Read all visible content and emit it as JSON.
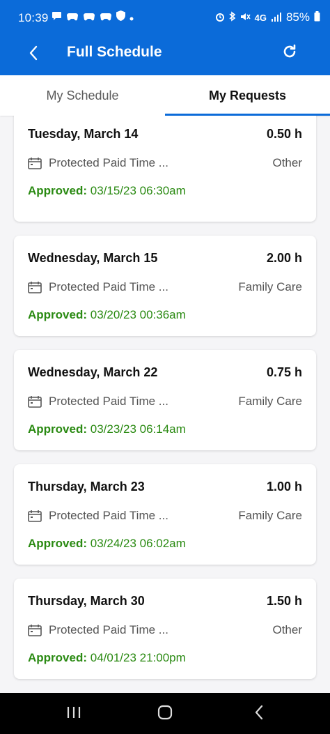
{
  "status_bar": {
    "time": "10:39",
    "network": "4G",
    "battery": "85%"
  },
  "app_bar": {
    "title": "Full Schedule",
    "back_icon": "chevron-left-icon",
    "refresh_icon": "refresh-icon"
  },
  "tabs": [
    {
      "label": "My Schedule",
      "active": false
    },
    {
      "label": "My Requests",
      "active": true
    }
  ],
  "requests": [
    {
      "date": "Tuesday, March 14",
      "hours": "0.50 h",
      "type": "Protected Paid Time ...",
      "category": "Other",
      "status": "Approved:",
      "timestamp": "03/15/23 06:30am"
    },
    {
      "date": "Wednesday, March 15",
      "hours": "2.00 h",
      "type": "Protected Paid Time ...",
      "category": "Family Care",
      "status": "Approved:",
      "timestamp": "03/20/23 00:36am"
    },
    {
      "date": "Wednesday, March 22",
      "hours": "0.75 h",
      "type": "Protected Paid Time ...",
      "category": "Family Care",
      "status": "Approved:",
      "timestamp": "03/23/23 06:14am"
    },
    {
      "date": "Thursday, March 23",
      "hours": "1.00 h",
      "type": "Protected Paid Time ...",
      "category": "Family Care",
      "status": "Approved:",
      "timestamp": "03/24/23 06:02am"
    },
    {
      "date": "Thursday, March 30",
      "hours": "1.50 h",
      "type": "Protected Paid Time ...",
      "category": "Other",
      "status": "Approved:",
      "timestamp": "04/01/23 21:00pm"
    }
  ],
  "colors": {
    "brand_blue": "#0b6bd9",
    "approved_green": "#2a8a12"
  }
}
